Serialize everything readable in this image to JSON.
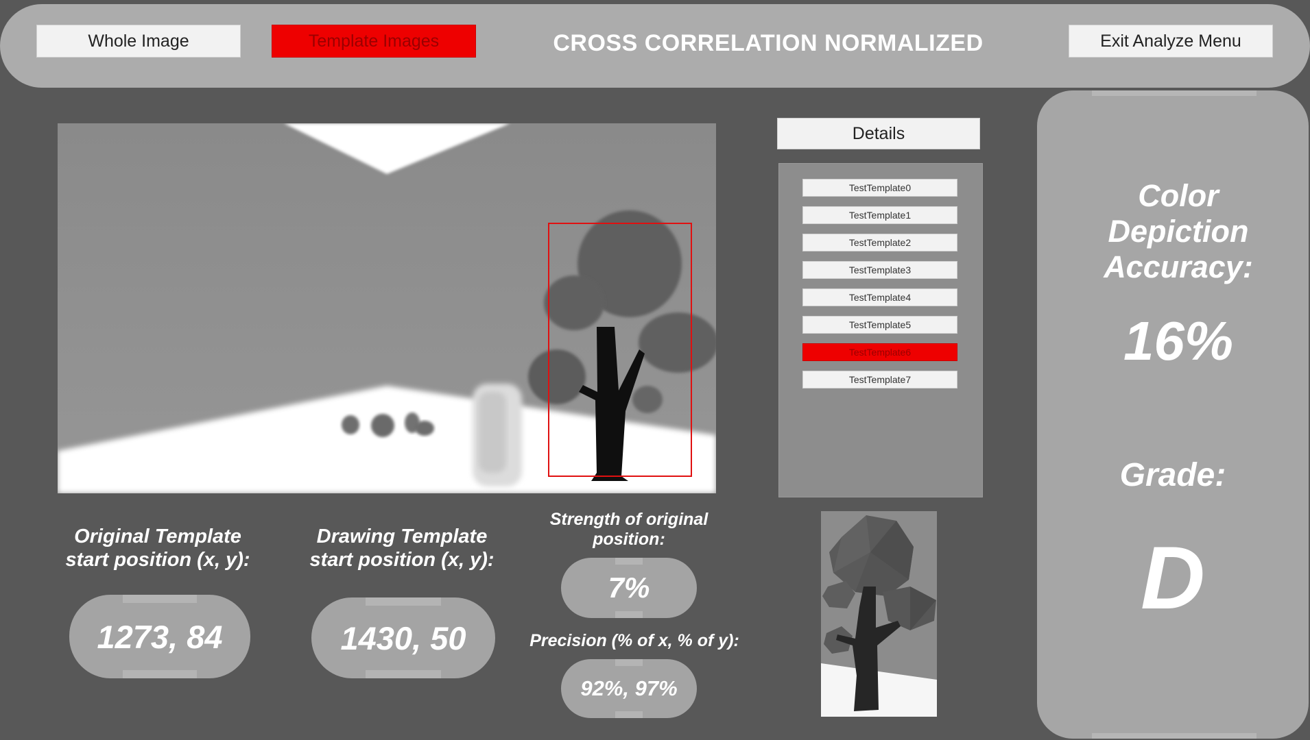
{
  "header": {
    "whole_image_label": "Whole Image",
    "template_images_label": "Template Images",
    "title": "CROSS CORRELATION NORMALIZED",
    "exit_label": "Exit Analyze Menu"
  },
  "details": {
    "button_label": "Details",
    "templates": [
      {
        "label": "TestTemplate0"
      },
      {
        "label": "TestTemplate1"
      },
      {
        "label": "TestTemplate2"
      },
      {
        "label": "TestTemplate3"
      },
      {
        "label": "TestTemplate4"
      },
      {
        "label": "TestTemplate5"
      },
      {
        "label": "TestTemplate6",
        "selected": true
      },
      {
        "label": "TestTemplate7"
      }
    ]
  },
  "stats": {
    "original_label_line1": "Original Template",
    "original_label_line2": "start position (x, y):",
    "original_value": "1273, 84",
    "drawing_label_line1": "Drawing Template",
    "drawing_label_line2": "start position (x, y):",
    "drawing_value": "1430, 50",
    "strength_label_line1": "Strength of original",
    "strength_label_line2": "position:",
    "strength_value": "7%",
    "precision_label": "Precision (% of x, % of y):",
    "precision_value": "92%, 97%"
  },
  "results": {
    "accuracy_line1": "Color",
    "accuracy_line2": "Depiction",
    "accuracy_line3": "Accuracy:",
    "accuracy_value": "16%",
    "grade_label": "Grade:",
    "grade_value": "D"
  },
  "colors": {
    "background": "#585858",
    "panel": "#acacac",
    "accent_red": "#ee0000"
  }
}
